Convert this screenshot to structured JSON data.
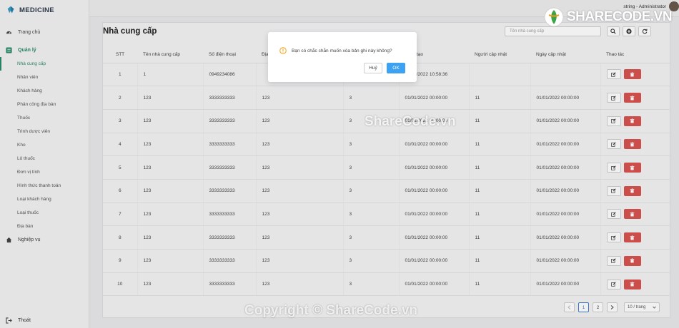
{
  "app": {
    "name": "MEDICINE"
  },
  "user": {
    "label": "string - Administrator"
  },
  "sidebar": {
    "home": "Trang chủ",
    "manage": "Quản lý",
    "items": [
      "Nhà cung cấp",
      "Nhân viên",
      "Khách hàng",
      "Phân công địa bàn",
      "Thuốc",
      "Trình dược viên",
      "Kho",
      "Lô thuốc",
      "Đơn vị tính",
      "Hình thức thanh toán",
      "Loại khách hàng",
      "Loại thuốc",
      "Địa bàn"
    ],
    "business": "Nghiệp vụ",
    "logout": "Thoát"
  },
  "page": {
    "title": "Nhà cung cấp",
    "search_placeholder": "Tên nhà cung cấp"
  },
  "table": {
    "headers": [
      "STT",
      "Tên nhà cung cấp",
      "Số điện thoại",
      "Địa",
      "",
      "Ngày tạo",
      "Người cập nhật",
      "Ngày cập nhật",
      "Thao tác"
    ],
    "rows": [
      [
        "1",
        "1",
        "0949234086",
        "",
        "",
        "15/01/2022 10:58:36",
        "",
        ""
      ],
      [
        "2",
        "123",
        "3333333333",
        "123",
        "3",
        "01/01/2022 00:00:00",
        "11",
        "01/01/2022 00:00:00"
      ],
      [
        "3",
        "123",
        "3333333333",
        "123",
        "3",
        "01/01/2022 00:00:00",
        "11",
        "01/01/2022 00:00:00"
      ],
      [
        "4",
        "123",
        "3333333333",
        "123",
        "3",
        "01/01/2022 00:00:00",
        "11",
        "01/01/2022 00:00:00"
      ],
      [
        "5",
        "123",
        "3333333333",
        "123",
        "3",
        "01/01/2022 00:00:00",
        "11",
        "01/01/2022 00:00:00"
      ],
      [
        "6",
        "123",
        "3333333333",
        "123",
        "3",
        "01/01/2022 00:00:00",
        "11",
        "01/01/2022 00:00:00"
      ],
      [
        "7",
        "123",
        "3333333333",
        "123",
        "3",
        "01/01/2022 00:00:00",
        "11",
        "01/01/2022 00:00:00"
      ],
      [
        "8",
        "123",
        "3333333333",
        "123",
        "3",
        "01/01/2022 00:00:00",
        "11",
        "01/01/2022 00:00:00"
      ],
      [
        "9",
        "123",
        "3333333333",
        "123",
        "3",
        "01/01/2022 00:00:00",
        "11",
        "01/01/2022 00:00:00"
      ],
      [
        "10",
        "123",
        "3333333333",
        "123",
        "3",
        "01/01/2022 00:00:00",
        "11",
        "01/01/2022 00:00:00"
      ]
    ]
  },
  "pagination": {
    "pages": [
      "1",
      "2"
    ],
    "current": "1",
    "page_size": "10 / trang"
  },
  "modal": {
    "message": "Bạn có chắc chắn muốn xóa bản ghi này không?",
    "cancel": "Huỷ",
    "ok": "OK"
  },
  "watermark": {
    "center": "ShareCode.vn",
    "bottom": "Copyright © ShareCode.vn",
    "logo": "SHARECODE.VN"
  },
  "colors": {
    "accent": "#2b8a66",
    "danger": "#d9534f",
    "primary": "#3ea2f2"
  }
}
